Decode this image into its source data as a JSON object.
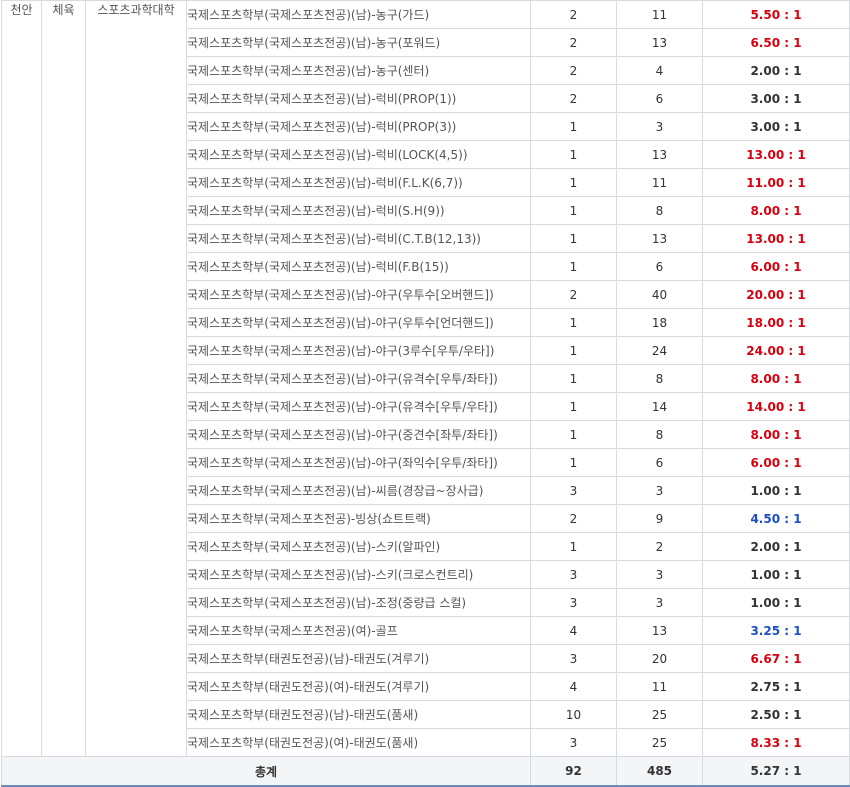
{
  "campus": "천안",
  "category": "체육",
  "college": "스포츠과학대학",
  "rows": [
    {
      "dept": "국제스포츠학부(국제스포츠전공)(남)-농구(가드)",
      "quota": "2",
      "applicants": "11",
      "ratio": "5.50 : 1",
      "tone": "red"
    },
    {
      "dept": "국제스포츠학부(국제스포츠전공)(남)-농구(포워드)",
      "quota": "2",
      "applicants": "13",
      "ratio": "6.50 : 1",
      "tone": "red"
    },
    {
      "dept": "국제스포츠학부(국제스포츠전공)(남)-농구(센터)",
      "quota": "2",
      "applicants": "4",
      "ratio": "2.00 : 1",
      "tone": "normal"
    },
    {
      "dept": "국제스포츠학부(국제스포츠전공)(남)-럭비(PROP(1))",
      "quota": "2",
      "applicants": "6",
      "ratio": "3.00 : 1",
      "tone": "normal"
    },
    {
      "dept": "국제스포츠학부(국제스포츠전공)(남)-럭비(PROP(3))",
      "quota": "1",
      "applicants": "3",
      "ratio": "3.00 : 1",
      "tone": "normal"
    },
    {
      "dept": "국제스포츠학부(국제스포츠전공)(남)-럭비(LOCK(4,5))",
      "quota": "1",
      "applicants": "13",
      "ratio": "13.00 : 1",
      "tone": "red"
    },
    {
      "dept": "국제스포츠학부(국제스포츠전공)(남)-럭비(F.L.K(6,7))",
      "quota": "1",
      "applicants": "11",
      "ratio": "11.00 : 1",
      "tone": "red"
    },
    {
      "dept": "국제스포츠학부(국제스포츠전공)(남)-럭비(S.H(9))",
      "quota": "1",
      "applicants": "8",
      "ratio": "8.00 : 1",
      "tone": "red"
    },
    {
      "dept": "국제스포츠학부(국제스포츠전공)(남)-럭비(C.T.B(12,13))",
      "quota": "1",
      "applicants": "13",
      "ratio": "13.00 : 1",
      "tone": "red"
    },
    {
      "dept": "국제스포츠학부(국제스포츠전공)(남)-럭비(F.B(15))",
      "quota": "1",
      "applicants": "6",
      "ratio": "6.00 : 1",
      "tone": "red"
    },
    {
      "dept": "국제스포츠학부(국제스포츠전공)(남)-야구(우투수[오버핸드])",
      "quota": "2",
      "applicants": "40",
      "ratio": "20.00 : 1",
      "tone": "red"
    },
    {
      "dept": "국제스포츠학부(국제스포츠전공)(남)-야구(우투수[언더핸드])",
      "quota": "1",
      "applicants": "18",
      "ratio": "18.00 : 1",
      "tone": "red"
    },
    {
      "dept": "국제스포츠학부(국제스포츠전공)(남)-야구(3루수[우투/우타])",
      "quota": "1",
      "applicants": "24",
      "ratio": "24.00 : 1",
      "tone": "red"
    },
    {
      "dept": "국제스포츠학부(국제스포츠전공)(남)-야구(유격수[우투/좌타])",
      "quota": "1",
      "applicants": "8",
      "ratio": "8.00 : 1",
      "tone": "red"
    },
    {
      "dept": "국제스포츠학부(국제스포츠전공)(남)-야구(유격수[우투/우타])",
      "quota": "1",
      "applicants": "14",
      "ratio": "14.00 : 1",
      "tone": "red"
    },
    {
      "dept": "국제스포츠학부(국제스포츠전공)(남)-야구(중견수[좌투/좌타])",
      "quota": "1",
      "applicants": "8",
      "ratio": "8.00 : 1",
      "tone": "red"
    },
    {
      "dept": "국제스포츠학부(국제스포츠전공)(남)-야구(좌익수[우투/좌타])",
      "quota": "1",
      "applicants": "6",
      "ratio": "6.00 : 1",
      "tone": "red"
    },
    {
      "dept": "국제스포츠학부(국제스포츠전공)(남)-씨름(경장급~장사급)",
      "quota": "3",
      "applicants": "3",
      "ratio": "1.00 : 1",
      "tone": "normal"
    },
    {
      "dept": "국제스포츠학부(국제스포츠전공)-빙상(쇼트트랙)",
      "quota": "2",
      "applicants": "9",
      "ratio": "4.50 : 1",
      "tone": "blue"
    },
    {
      "dept": "국제스포츠학부(국제스포츠전공)(남)-스키(알파인)",
      "quota": "1",
      "applicants": "2",
      "ratio": "2.00 : 1",
      "tone": "normal"
    },
    {
      "dept": "국제스포츠학부(국제스포츠전공)(남)-스키(크로스컨트리)",
      "quota": "3",
      "applicants": "3",
      "ratio": "1.00 : 1",
      "tone": "normal"
    },
    {
      "dept": "국제스포츠학부(국제스포츠전공)(남)-조정(중량급 스컬)",
      "quota": "3",
      "applicants": "3",
      "ratio": "1.00 : 1",
      "tone": "normal"
    },
    {
      "dept": "국제스포츠학부(국제스포츠전공)(여)-골프",
      "quota": "4",
      "applicants": "13",
      "ratio": "3.25 : 1",
      "tone": "blue"
    },
    {
      "dept": "국제스포츠학부(태권도전공)(남)-태권도(겨루기)",
      "quota": "3",
      "applicants": "20",
      "ratio": "6.67 : 1",
      "tone": "red"
    },
    {
      "dept": "국제스포츠학부(태권도전공)(여)-태권도(겨루기)",
      "quota": "4",
      "applicants": "11",
      "ratio": "2.75 : 1",
      "tone": "normal"
    },
    {
      "dept": "국제스포츠학부(태권도전공)(남)-태권도(품새)",
      "quota": "10",
      "applicants": "25",
      "ratio": "2.50 : 1",
      "tone": "normal"
    },
    {
      "dept": "국제스포츠학부(태권도전공)(여)-태권도(품새)",
      "quota": "3",
      "applicants": "25",
      "ratio": "8.33 : 1",
      "tone": "red"
    }
  ],
  "total": {
    "label": "총계",
    "quota": "92",
    "applicants": "485",
    "ratio": "5.27 : 1"
  },
  "colors": {
    "red": "#d7000f",
    "blue": "#1b4ec9",
    "normal": "#333333",
    "border": "#d6dbe3",
    "total_bg": "#f4f5f7"
  }
}
